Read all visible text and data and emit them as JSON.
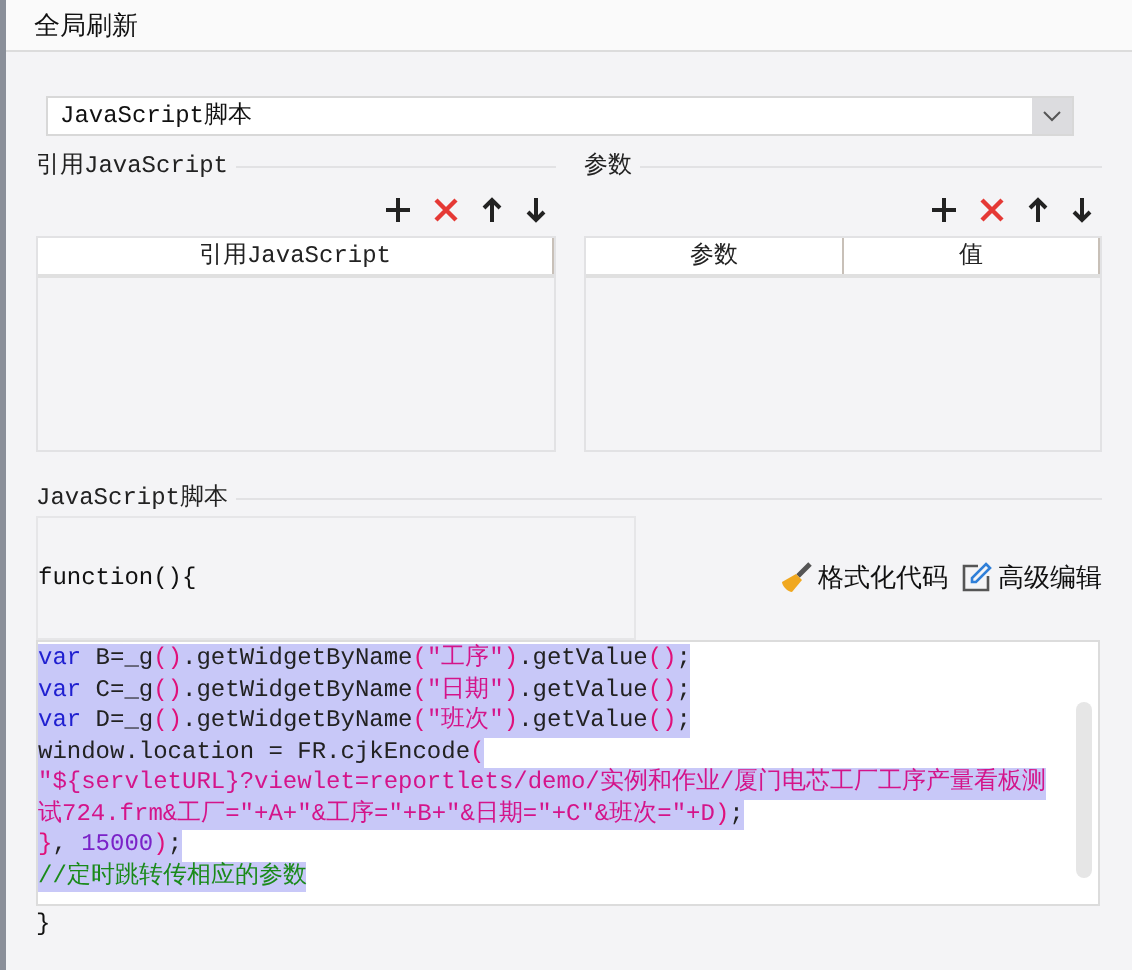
{
  "window": {
    "title": "全局刷新"
  },
  "script_type": {
    "value": "JavaScript脚本"
  },
  "ref_section": {
    "label": "引用JavaScript",
    "toolbar": [
      {
        "kind": "add"
      },
      {
        "kind": "delete"
      },
      {
        "kind": "up"
      },
      {
        "kind": "down"
      }
    ],
    "columns": [
      "引用JavaScript"
    ]
  },
  "param_section": {
    "label": "参数",
    "toolbar": [
      {
        "kind": "add"
      },
      {
        "kind": "delete"
      },
      {
        "kind": "up"
      },
      {
        "kind": "down"
      }
    ],
    "columns": [
      "参数",
      "值"
    ]
  },
  "script_section": {
    "label": "JavaScript脚本",
    "header": "function(){",
    "actions": [
      {
        "kind": "format",
        "label": "格式化代码"
      },
      {
        "kind": "edit",
        "label": "高级编辑"
      }
    ],
    "code_lines": [
      {
        "selected": true,
        "tokens": [
          {
            "kind": "keyword",
            "text": "var"
          },
          {
            "kind": "plain",
            "text": " B=_g"
          },
          {
            "kind": "paren",
            "text": "()"
          },
          {
            "kind": "plain",
            "text": ".getWidgetByName"
          },
          {
            "kind": "paren",
            "text": "("
          },
          {
            "kind": "string",
            "text": "\"工序\""
          },
          {
            "kind": "paren",
            "text": ")"
          },
          {
            "kind": "plain",
            "text": ".getValue"
          },
          {
            "kind": "paren",
            "text": "()"
          },
          {
            "kind": "plain",
            "text": ";"
          }
        ]
      },
      {
        "selected": true,
        "tokens": [
          {
            "kind": "keyword",
            "text": "var"
          },
          {
            "kind": "plain",
            "text": " C=_g"
          },
          {
            "kind": "paren",
            "text": "()"
          },
          {
            "kind": "plain",
            "text": ".getWidgetByName"
          },
          {
            "kind": "paren",
            "text": "("
          },
          {
            "kind": "string",
            "text": "\"日期\""
          },
          {
            "kind": "paren",
            "text": ")"
          },
          {
            "kind": "plain",
            "text": ".getValue"
          },
          {
            "kind": "paren",
            "text": "()"
          },
          {
            "kind": "plain",
            "text": ";"
          }
        ]
      },
      {
        "selected": true,
        "tokens": [
          {
            "kind": "keyword",
            "text": "var"
          },
          {
            "kind": "plain",
            "text": " D=_g"
          },
          {
            "kind": "paren",
            "text": "()"
          },
          {
            "kind": "plain",
            "text": ".getWidgetByName"
          },
          {
            "kind": "paren",
            "text": "("
          },
          {
            "kind": "string",
            "text": "\"班次\""
          },
          {
            "kind": "paren",
            "text": ")"
          },
          {
            "kind": "plain",
            "text": ".getValue"
          },
          {
            "kind": "paren",
            "text": "()"
          },
          {
            "kind": "plain",
            "text": ";"
          }
        ]
      },
      {
        "selected": true,
        "tokens": [
          {
            "kind": "plain",
            "text": "window.location = FR.cjkEncode"
          },
          {
            "kind": "paren",
            "text": "("
          }
        ]
      },
      {
        "selected": true,
        "tokens": [
          {
            "kind": "string",
            "text": "\"${servletURL}?viewlet=reportlets/demo/实例和作业/厦门电芯工厂工序产量看板测"
          }
        ]
      },
      {
        "selected": true,
        "tokens": [
          {
            "kind": "string",
            "text": "试724.frm&工厂=\"+A+\"&工序=\"+B+\"&日期=\"+C\"&班次=\"+D"
          },
          {
            "kind": "paren",
            "text": ")"
          },
          {
            "kind": "plain",
            "text": ";"
          }
        ]
      },
      {
        "selected": true,
        "tokens": [
          {
            "kind": "paren",
            "text": "}"
          },
          {
            "kind": "plain",
            "text": ", "
          },
          {
            "kind": "number",
            "text": "15000"
          },
          {
            "kind": "paren",
            "text": ")"
          },
          {
            "kind": "plain",
            "text": ";"
          }
        ]
      },
      {
        "selected": true,
        "tokens": [
          {
            "kind": "comment",
            "text": "//定时跳转传相应的参数"
          }
        ]
      }
    ],
    "footer": "}"
  }
}
